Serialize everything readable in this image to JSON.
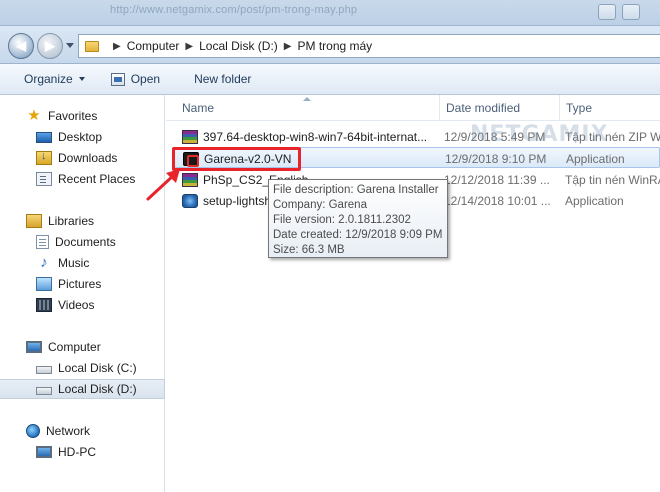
{
  "titlebar": {
    "ghost_url": "http://www.netgamix.com/post/pm-trong-may.php"
  },
  "address_bar": {
    "crumbs": [
      "Computer",
      "Local Disk (D:)",
      "PM trong máy"
    ]
  },
  "toolbar": {
    "organize_label": "Organize",
    "open_label": "Open",
    "new_folder_label": "New folder"
  },
  "nav_pane": {
    "favorites": {
      "label": "Favorites",
      "items": [
        "Desktop",
        "Downloads",
        "Recent Places"
      ]
    },
    "libraries": {
      "label": "Libraries",
      "items": [
        "Documents",
        "Music",
        "Pictures",
        "Videos"
      ]
    },
    "computer": {
      "label": "Computer",
      "items": [
        "Local Disk (C:)",
        "Local Disk (D:)"
      ],
      "selected": "Local Disk (D:)"
    },
    "network": {
      "label": "Network",
      "items": [
        "HD-PC"
      ]
    }
  },
  "columns": {
    "name": "Name",
    "date_modified": "Date modified",
    "type": "Type"
  },
  "files": [
    {
      "name": "397.64-desktop-win8-win7-64bit-internat...",
      "date": "12/9/2018 5:49 PM",
      "type": "Tập tin nén ZIP W",
      "icon": "winrar-archive-icon"
    },
    {
      "name": "Garena-v2.0-VN",
      "date": "12/9/2018 9:10 PM",
      "type": "Application",
      "icon": "garena-app-icon",
      "selected": true
    },
    {
      "name": "PhSp_CS2_English",
      "date": "12/12/2018 11:39 ...",
      "type": "Tập tin nén WinRA",
      "icon": "winrar-archive-icon"
    },
    {
      "name": "setup-lightshot",
      "date": "12/14/2018 10:01 ...",
      "type": "Application",
      "icon": "setup-app-icon"
    }
  ],
  "tooltip": {
    "lines": [
      "File description: Garena Installer",
      "Company: Garena",
      "File version: 2.0.1811.2302",
      "Date created: 12/9/2018 9:09 PM",
      "Size: 66.3 MB"
    ]
  },
  "watermark": "NETGAMIX",
  "colors": {
    "highlight_box": "#e8232a",
    "selection": "#dbe9f8",
    "accent": "#1e3a5a"
  }
}
